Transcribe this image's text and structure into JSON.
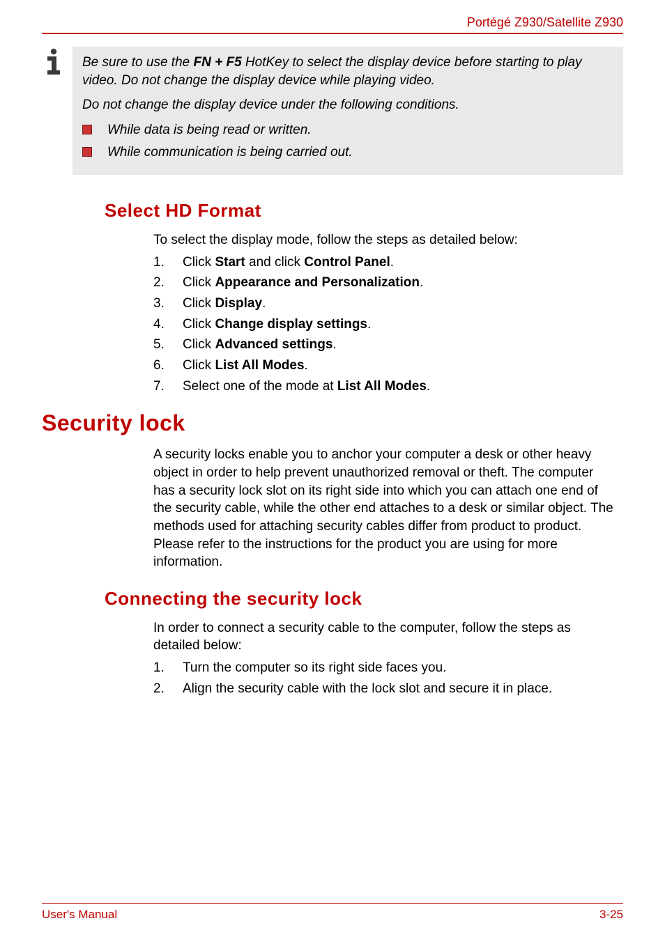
{
  "header": {
    "product": "Portégé Z930/Satellite Z930"
  },
  "note": {
    "line1_pre": "Be sure to use the ",
    "line1_hotkey": "FN + F5",
    "line1_post": " HotKey to select the display device before starting to play video. Do not change the display device while playing video.",
    "line2": "Do not change the display device under the following conditions.",
    "bullets": [
      "While data is being read or written.",
      "While communication is being carried out."
    ]
  },
  "sections": {
    "select_hd": {
      "heading": "Select HD Format",
      "intro": "To select the display mode, follow the steps as detailed below:",
      "steps": [
        {
          "n": "1.",
          "pre": "Click ",
          "b1": "Start",
          "mid": " and click ",
          "b2": "Control Panel",
          "post": "."
        },
        {
          "n": "2.",
          "pre": "Click ",
          "b1": "Appearance and Personalization",
          "mid": "",
          "b2": "",
          "post": "."
        },
        {
          "n": "3.",
          "pre": "Click ",
          "b1": "Display",
          "mid": "",
          "b2": "",
          "post": "."
        },
        {
          "n": "4.",
          "pre": "Click ",
          "b1": "Change display settings",
          "mid": "",
          "b2": "",
          "post": "."
        },
        {
          "n": "5.",
          "pre": "Click ",
          "b1": "Advanced settings",
          "mid": "",
          "b2": "",
          "post": "."
        },
        {
          "n": "6.",
          "pre": "Click ",
          "b1": "List All Modes",
          "mid": "",
          "b2": "",
          "post": "."
        },
        {
          "n": "7.",
          "pre": "Select one of the mode at ",
          "b1": "List All Modes",
          "mid": "",
          "b2": "",
          "post": "."
        }
      ]
    },
    "security_lock": {
      "heading": "Security lock",
      "body": "A security locks enable you to anchor your computer a desk or other heavy object in order to help prevent unauthorized removal or theft. The computer has a security lock slot on its right side into which you can attach one end of the security cable, while the other end attaches to a desk or similar object. The methods used for attaching security cables differ from product to product. Please refer to the instructions for the product you are using for more information."
    },
    "connecting": {
      "heading": "Connecting the security lock",
      "intro": "In order to connect a security cable to the computer, follow the steps as detailed below:",
      "steps": [
        {
          "n": "1.",
          "text": "Turn the computer so its right side faces you."
        },
        {
          "n": "2.",
          "text": "Align the security cable with the lock slot and secure it in place."
        }
      ]
    }
  },
  "footer": {
    "left": "User's Manual",
    "right": "3-25"
  }
}
